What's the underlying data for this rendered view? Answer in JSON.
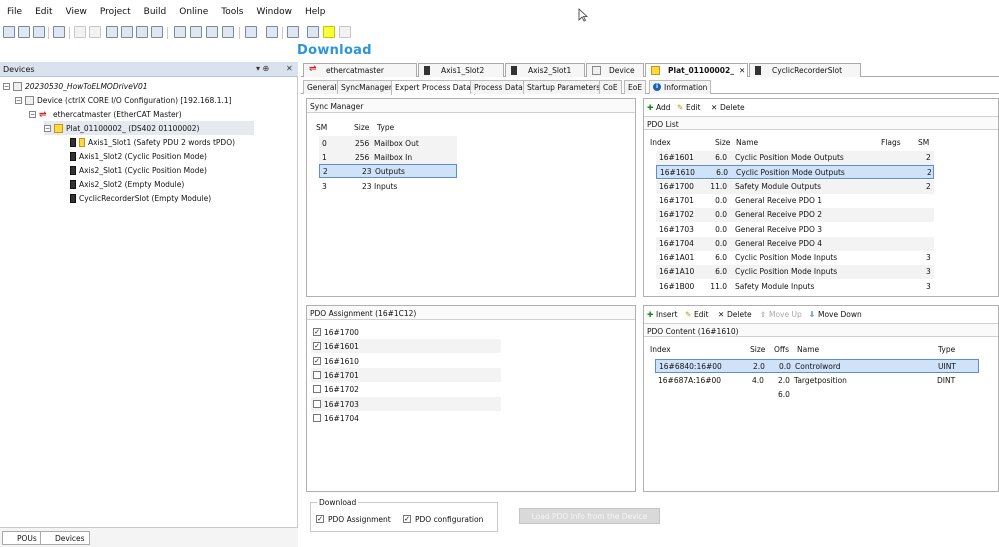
{
  "menu": [
    "File",
    "Edit",
    "View",
    "Project",
    "Build",
    "Online",
    "Tools",
    "Window",
    "Help"
  ],
  "overlay_title": "Download",
  "devices": {
    "title": "Devices",
    "pin": "▾  ⊕",
    "close": "✕",
    "tree": [
      {
        "label": "20230530_HowToELMODriveV01"
      },
      {
        "label": "Device (ctrlX CORE I/O Configuration) [192.168.1.1]"
      },
      {
        "label": "ethercatmaster (EtherCAT Master)"
      },
      {
        "label": "Plat_01100002_ (DS402 01100002)"
      },
      {
        "label": "Axis1_Slot1 (Safety PDU 2 words tPDO)"
      },
      {
        "label": "Axis1_Slot2 (Cyclic Position Mode)"
      },
      {
        "label": "Axis2_Slot1 (Cyclic Position Mode)"
      },
      {
        "label": "Axis2_Slot2 (Empty Module)"
      },
      {
        "label": "CyclicRecorderSlot (Empty Module)"
      }
    ],
    "bottom_tabs": [
      "POUs",
      "Devices"
    ]
  },
  "doc_tabs": [
    "ethercatmaster",
    "Axis1_Slot2",
    "Axis2_Slot1",
    "Device",
    "Plat_01100002_",
    "CyclicRecorderSlot"
  ],
  "doc_close": "✕",
  "sub_tabs": [
    "General",
    "SyncManager",
    "Expert Process Data",
    "Process Data",
    "Startup Parameters",
    "CoE",
    "EoE",
    "Information"
  ],
  "sync_manager": {
    "title": "Sync Manager",
    "headers": [
      "SM",
      "Size",
      "Type"
    ],
    "rows": [
      [
        "0",
        "256",
        "Mailbox Out"
      ],
      [
        "1",
        "256",
        "Mailbox In"
      ],
      [
        "2",
        "23",
        "Outputs"
      ],
      [
        "3",
        "23",
        "Inputs"
      ]
    ]
  },
  "pdo_list": {
    "toolbar": [
      "Add",
      "Edit",
      "Delete"
    ],
    "title": "PDO List",
    "headers": [
      "Index",
      "Size",
      "Name",
      "Flags",
      "SM"
    ],
    "rows": [
      [
        "16#1601",
        "6.0",
        "Cyclic Position Mode Outputs",
        "",
        "2"
      ],
      [
        "16#1610",
        "6.0",
        "Cyclic Position Mode Outputs",
        "",
        "2"
      ],
      [
        "16#1700",
        "11.0",
        "Safety Module Outputs",
        "",
        "2"
      ],
      [
        "16#1701",
        "0.0",
        "General Receive PDO 1",
        "",
        ""
      ],
      [
        "16#1702",
        "0.0",
        "General Receive PDO 2",
        "",
        ""
      ],
      [
        "16#1703",
        "0.0",
        "General Receive PDO 3",
        "",
        ""
      ],
      [
        "16#1704",
        "0.0",
        "General Receive PDO 4",
        "",
        ""
      ],
      [
        "16#1A01",
        "6.0",
        "Cyclic Position Mode Inputs",
        "",
        "3"
      ],
      [
        "16#1A10",
        "6.0",
        "Cyclic Position Mode Inputs",
        "",
        "3"
      ],
      [
        "16#1B00",
        "11.0",
        "Safety Module Inputs",
        "",
        "3"
      ]
    ]
  },
  "pdo_assignment": {
    "title": "PDO Assignment (16#1C12)",
    "items": [
      {
        "label": "16#1700",
        "checked": "✓"
      },
      {
        "label": "16#1601",
        "checked": "✓"
      },
      {
        "label": "16#1610",
        "checked": "✓"
      },
      {
        "label": "16#1701",
        "checked": ""
      },
      {
        "label": "16#1702",
        "checked": ""
      },
      {
        "label": "16#1703",
        "checked": ""
      },
      {
        "label": "16#1704",
        "checked": ""
      }
    ]
  },
  "pdo_content": {
    "toolbar": [
      "Insert",
      "Edit",
      "Delete",
      "Move Up",
      "Move Down"
    ],
    "title": "PDO Content (16#1610)",
    "headers": [
      "Index",
      "Size",
      "Offs",
      "Name",
      "Type"
    ],
    "rows": [
      [
        "16#6840:16#00",
        "2.0",
        "0.0",
        "Controlword",
        "UINT"
      ],
      [
        "16#687A:16#00",
        "4.0",
        "2.0",
        "Targetposition",
        "DINT"
      ],
      [
        "",
        "",
        "6.0",
        "",
        ""
      ]
    ]
  },
  "download": {
    "title": "Download",
    "pdo_assignment": "PDO Assignment",
    "pdo_configuration": "PDO configuration",
    "check": "✓",
    "load_button": "Load PDO Info from the Device"
  },
  "colors": {
    "accent": "#2b95d9",
    "highlight": "#f4ff37",
    "selection": "#cfe2f8"
  }
}
